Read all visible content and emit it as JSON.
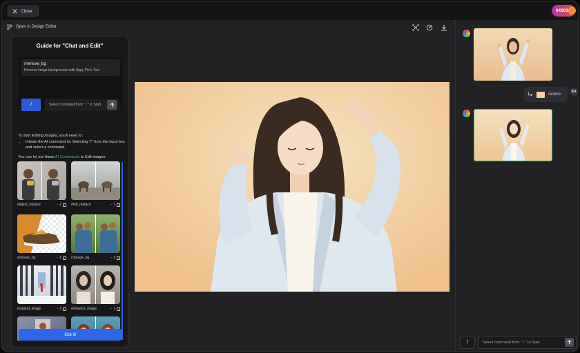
{
  "topbar": {
    "close_label": "Close",
    "credits": "64303"
  },
  "toolbar": {
    "open_editor_label": "Open in Design Editor",
    "icons": [
      "fit-screen-icon",
      "edit-badge-icon",
      "download-icon"
    ]
  },
  "guide": {
    "title": "Guide for \"Chat and Edit\"",
    "command": {
      "name": "/remove_bg",
      "description": "Remove image backgrounds with Appy Pie's Tool"
    },
    "slash_label": "/",
    "input_placeholder": "Select command from \" / \" to Start",
    "intro_text": "To start Editing images, you'll need to:",
    "intro_bullet": "Initiate the AI command by Selecting \"/\" from the input box and select a command.",
    "try_prefix": "You can try our these ",
    "try_link": "AI Commands",
    "try_suffix": " to Edit images:",
    "cards": [
      {
        "label": "/object_replace",
        "count": "2"
      },
      {
        "label": "/find_replace",
        "count": "1"
      },
      {
        "label": "/remove_bg",
        "count": "1"
      },
      {
        "label": "/change_bg",
        "count": "1"
      },
      {
        "label": "/expand_image",
        "count": "3"
      },
      {
        "label": "/enhance_image",
        "count": "1"
      },
      {
        "label": "",
        "count": ""
      },
      {
        "label": "",
        "count": ""
      }
    ],
    "count_prefix": "- ",
    "got_it_label": "Got it!"
  },
  "chat": {
    "user_command": "/anime",
    "user_initials": "SU",
    "input_slash": "/",
    "input_placeholder": "Select command from \" / \" to Start"
  },
  "colors": {
    "accent_blue": "#2d66e8",
    "credits_gradient_start": "#b02fb6",
    "credits_gradient_end": "#e35a2c",
    "green_link": "#3fc37a",
    "peach_bg": "#f4c796"
  }
}
